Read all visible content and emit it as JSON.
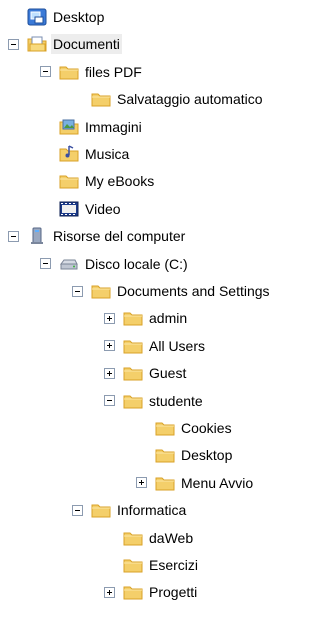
{
  "tree": {
    "items": [
      {
        "label": "Desktop",
        "depth": 0,
        "expander": "none",
        "icon": "desktop-icon",
        "selected": false
      },
      {
        "label": "Documenti",
        "depth": 0,
        "expander": "minus",
        "icon": "documents-folder-icon",
        "selected": true
      },
      {
        "label": "files PDF",
        "depth": 1,
        "expander": "minus",
        "icon": "folder-icon",
        "selected": false
      },
      {
        "label": "Salvataggio automatico",
        "depth": 2,
        "expander": "none",
        "icon": "folder-icon",
        "selected": false
      },
      {
        "label": "Immagini",
        "depth": 1,
        "expander": "none",
        "icon": "pictures-folder-icon",
        "selected": false
      },
      {
        "label": "Musica",
        "depth": 1,
        "expander": "none",
        "icon": "music-folder-icon",
        "selected": false
      },
      {
        "label": "My eBooks",
        "depth": 1,
        "expander": "none",
        "icon": "folder-icon",
        "selected": false
      },
      {
        "label": "Video",
        "depth": 1,
        "expander": "none",
        "icon": "video-folder-icon",
        "selected": false
      },
      {
        "label": "Risorse del computer",
        "depth": 0,
        "expander": "minus",
        "icon": "computer-icon",
        "selected": false
      },
      {
        "label": "Disco locale (C:)",
        "depth": 1,
        "expander": "minus",
        "icon": "drive-icon",
        "selected": false
      },
      {
        "label": "Documents and Settings",
        "depth": 2,
        "expander": "minus",
        "icon": "folder-icon",
        "selected": false
      },
      {
        "label": "admin",
        "depth": 3,
        "expander": "plus",
        "icon": "folder-icon",
        "selected": false
      },
      {
        "label": "All Users",
        "depth": 3,
        "expander": "plus",
        "icon": "folder-icon",
        "selected": false
      },
      {
        "label": "Guest",
        "depth": 3,
        "expander": "plus",
        "icon": "folder-icon",
        "selected": false
      },
      {
        "label": "studente",
        "depth": 3,
        "expander": "minus",
        "icon": "folder-icon",
        "selected": false
      },
      {
        "label": "Cookies",
        "depth": 4,
        "expander": "none",
        "icon": "folder-icon",
        "selected": false
      },
      {
        "label": "Desktop",
        "depth": 4,
        "expander": "none",
        "icon": "folder-icon",
        "selected": false
      },
      {
        "label": "Menu Avvio",
        "depth": 4,
        "expander": "plus",
        "icon": "folder-icon",
        "selected": false
      },
      {
        "label": "Informatica",
        "depth": 2,
        "expander": "minus",
        "icon": "folder-icon",
        "selected": false
      },
      {
        "label": "daWeb",
        "depth": 3,
        "expander": "none",
        "icon": "folder-icon",
        "selected": false
      },
      {
        "label": "Esercizi",
        "depth": 3,
        "expander": "none",
        "icon": "folder-icon",
        "selected": false
      },
      {
        "label": "Progetti",
        "depth": 3,
        "expander": "plus",
        "icon": "folder-icon",
        "selected": false
      }
    ]
  },
  "colors": {
    "folder": "#f4cf6a",
    "folder_dark": "#d9a227",
    "selection": "#ededed",
    "expander_border": "#8c9bb0"
  }
}
